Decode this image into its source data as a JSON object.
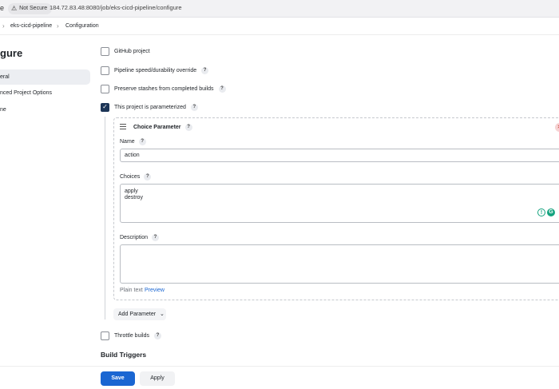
{
  "browser": {
    "edge_char": "e",
    "security_label": "Not Secure",
    "url": "184.72.83.48:8080/job/eks-cicd-pipeline/configure"
  },
  "breadcrumb": {
    "items": [
      "eks-cicd-pipeline",
      "Configuration"
    ]
  },
  "sidebar": {
    "title": "gure",
    "items": [
      {
        "label": "eral"
      },
      {
        "label": "nced Project Options"
      },
      {
        "label": "ne"
      }
    ]
  },
  "options": {
    "github_project": "GitHub project",
    "pipeline_speed": "Pipeline speed/durability override",
    "preserve_stashes": "Preserve stashes from completed builds",
    "parameterized": "This project is parameterized",
    "throttle": "Throttle builds"
  },
  "parameter": {
    "title": "Choice Parameter",
    "name_label": "Name",
    "name_value": "action",
    "choices_label": "Choices",
    "choices_value": "apply\ndestroy",
    "description_label": "Description",
    "description_value": "",
    "plain_text": "Plain text",
    "preview": "Preview"
  },
  "add_parameter_label": "Add Parameter",
  "section": {
    "build_triggers": "Build Triggers"
  },
  "buttons": {
    "save": "Save",
    "apply": "Apply"
  },
  "help_char": "?",
  "colors": {
    "primary": "#1a66d2",
    "checked": "#1d3557",
    "grammarly": "#15a37f"
  }
}
